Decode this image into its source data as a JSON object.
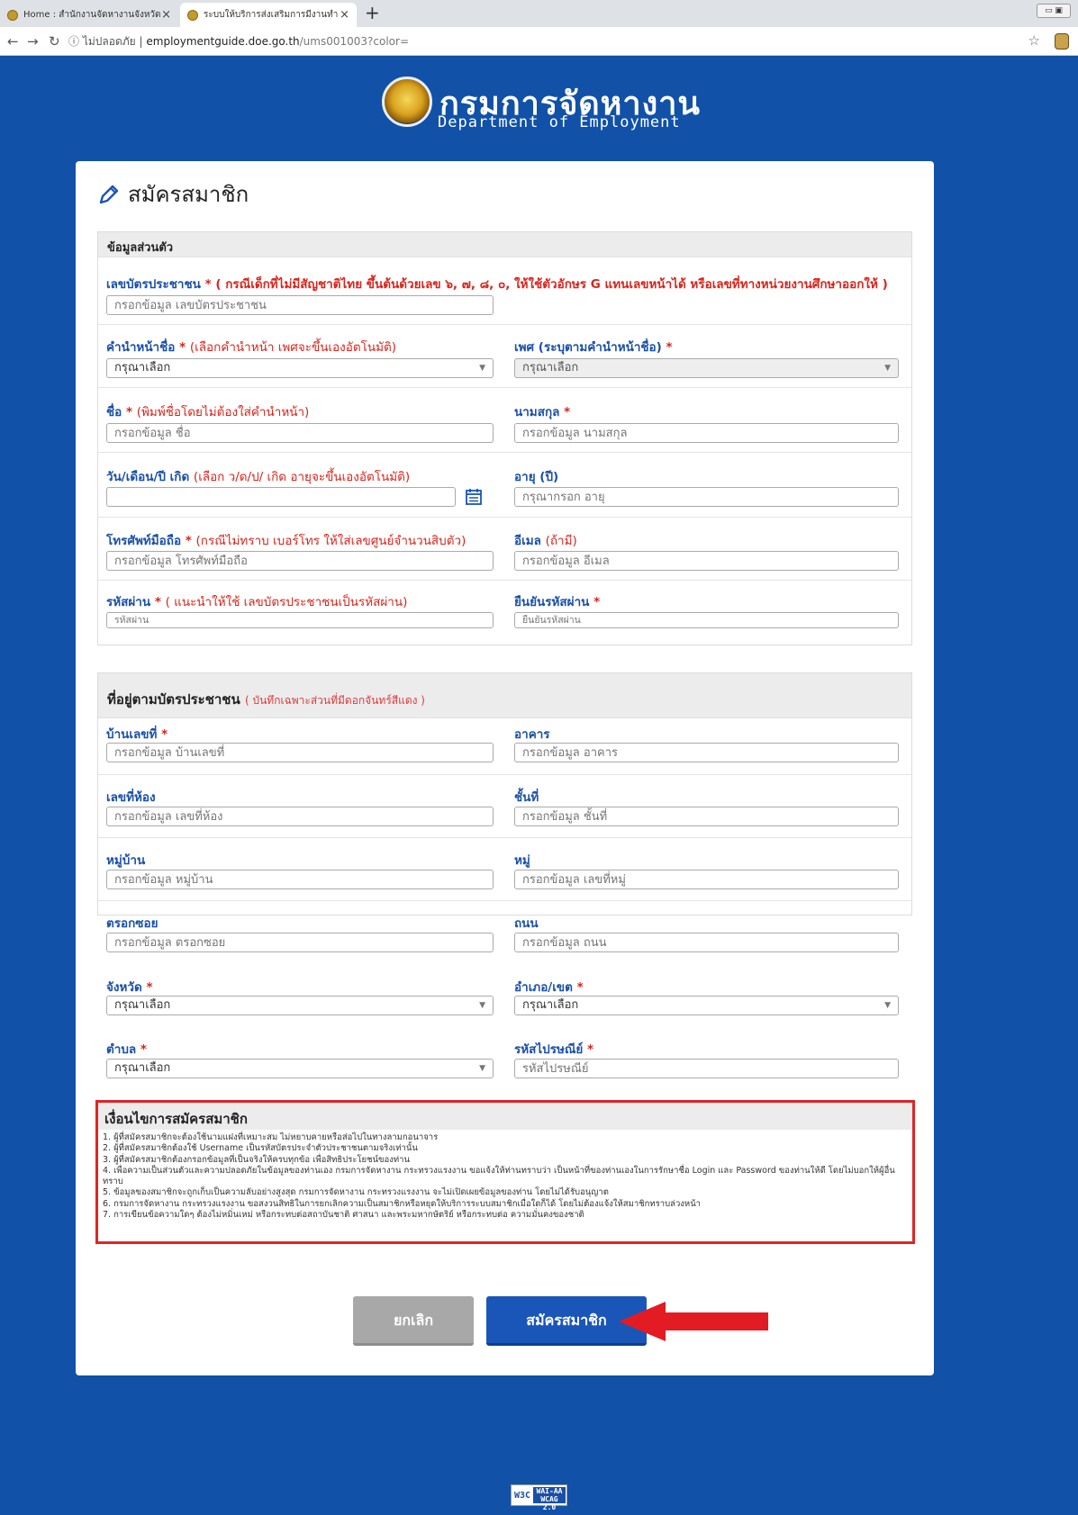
{
  "browser": {
    "tabs": [
      {
        "title": "Home : สำนักงานจัดหางานจังหวัดแม่ฮ่"
      },
      {
        "title": "ระบบให้บริการส่งเสริมการมีงานทำ"
      }
    ],
    "new_tab": "+",
    "close": "×",
    "security": "ไม่ปลอดภัย",
    "url_host": "employmentguide.doe.go.th",
    "url_path": "/ums001003?color="
  },
  "header": {
    "title": "กรมการจัดหางาน",
    "subtitle": "Department of Employment"
  },
  "page_title": "สมัครสมาชิก",
  "personal": {
    "heading": "ข้อมูลส่วนตัว",
    "id_card": {
      "label": "เลขบัตรประชาชน",
      "note": "( กรณีเด็กที่ไม่มีสัญชาติไทย ขึ้นต้นด้วยเลข ๖, ๗, ๘, ๐, ให้ใช้ตัวอักษร G แทนเลขหน้าได้ หรือเลขที่ทางหน่วยงานศึกษาออกให้ )",
      "placeholder": "กรอกข้อมูล เลขบัตรประชาชน"
    },
    "prefix": {
      "label": "คำนำหน้าชื่อ",
      "note": "(เลือกคำนำหน้า เพศจะขึ้นเองอัตโนมัติ)",
      "value": "กรุณาเลือก"
    },
    "gender": {
      "label": "เพศ (ระบุตามคำนำหน้าชื่อ)",
      "value": "กรุณาเลือก"
    },
    "first_name": {
      "label": "ชื่อ",
      "note": "(พิมพ์ชื่อโดยไม่ต้องใส่คำนำหน้า)",
      "placeholder": "กรอกข้อมูล ชื่อ"
    },
    "last_name": {
      "label": "นามสกุล",
      "placeholder": "กรอกข้อมูล นามสกุล"
    },
    "birth_date": {
      "label": "วัน/เดือน/ปี เกิด",
      "note": "(เลือก ว/ด/ป/ เกิด อายุจะขึ้นเองอัตโนมัติ)",
      "value": ""
    },
    "age": {
      "label": "อายุ (ปี)",
      "placeholder": "กรุณากรอก อายุ"
    },
    "mobile": {
      "label": "โทรศัพท์มือถือ",
      "note": "(กรณีไม่ทราบ เบอร์โทร ให้ใส่เลขศูนย์จำนวนสิบตัว)",
      "placeholder": "กรอกข้อมูล โทรศัพท์มือถือ"
    },
    "email": {
      "label": "อีเมล",
      "note": "(ถ้ามี)",
      "placeholder": "กรอกข้อมูล อีเมล"
    },
    "password": {
      "label": "รหัสผ่าน",
      "note": "( แนะนำให้ใช้ เลขบัตรประชาชนเป็นรหัสผ่าน)",
      "placeholder": "รหัสผ่าน"
    },
    "password_confirm": {
      "label": "ยืนยันรหัสผ่าน",
      "placeholder": "ยืนยันรหัสผ่าน"
    }
  },
  "address": {
    "heading": "ที่อยู่ตามบัตรประชาชน",
    "heading_note": "( บันทึกเฉพาะส่วนที่มีดอกจันทร์สีแดง )",
    "house_no": {
      "label": "บ้านเลขที่",
      "placeholder": "กรอกข้อมูล บ้านเลขที่"
    },
    "building": {
      "label": "อาคาร",
      "placeholder": "กรอกข้อมูล อาคาร"
    },
    "room_no": {
      "label": "เลขที่ห้อง",
      "placeholder": "กรอกข้อมูล เลขที่ห้อง"
    },
    "floor": {
      "label": "ชั้นที่",
      "placeholder": "กรอกข้อมูล ชั้นที่"
    },
    "village": {
      "label": "หมู่บ้าน",
      "placeholder": "กรอกข้อมูล หมู่บ้าน"
    },
    "moo": {
      "label": "หมู่",
      "placeholder": "กรอกข้อมูล เลขที่หมู่"
    },
    "soi": {
      "label": "ตรอกซอย",
      "placeholder": "กรอกข้อมูล ตรอกซอย"
    },
    "road": {
      "label": "ถนน",
      "placeholder": "กรอกข้อมูล ถนน"
    },
    "province": {
      "label": "จังหวัด",
      "value": "กรุณาเลือก"
    },
    "district": {
      "label": "อำเภอ/เขต",
      "value": "กรุณาเลือก"
    },
    "subdistrict": {
      "label": "ตำบล",
      "value": "กรุณาเลือก"
    },
    "postcode": {
      "label": "รหัสไปรษณีย์",
      "placeholder": "รหัสไปรษณีย์"
    }
  },
  "terms": {
    "heading": "เงื่อนไขการสมัครสมาชิก",
    "items": [
      "1. ผู้ที่สมัครสมาชิกจะต้องใช้นามแฝงที่เหมาะสม ไม่หยาบคายหรือส่อไปในทางลามกอนาจาร",
      "2. ผู้ที่สมัครสมาชิกต้องใช้ Username เป็นรหัสบัตรประจำตัวประชาชนตามจริงเท่านั้น",
      "3. ผู้ที่สมัครสมาชิกต้องกรอกข้อมูลที่เป็นจริงให้ครบทุกข้อ เพื่อสิทธิประโยชน์ของท่าน",
      "4. เพื่อความเป็นส่วนตัวและความปลอดภัยในข้อมูลของท่านเอง กรมการจัดหางาน กระทรวงแรงงาน ขอแจ้งให้ท่านทราบว่า เป็นหน้าที่ของท่านเองในการรักษาชื่อ Login และ Password ของท่านให้ดี โดยไม่บอกให้ผู้อื่นทราบ",
      "5. ข้อมูลของสมาชิกจะถูกเก็บเป็นความลับอย่างสูงสุด กรมการจัดหางาน กระทรวงแรงงาน จะไม่เปิดเผยข้อมูลของท่าน โดยไม่ได้รับอนุญาต",
      "6. กรมการจัดหางาน กระทรวงแรงงาน ขอสงวนสิทธิในการยกเลิกความเป็นสมาชิกหรือหยุดให้บริการระบบสมาชิกเมื่อใดก็ได้ โดยไม่ต้องแจ้งให้สมาชิกทราบล่วงหน้า",
      "7. การเขียนข้อความใดๆ ต้องไม่หมิ่นเหม่ หรือกระทบต่อสถาบันชาติ ศาสนา และพระมหากษัตริย์ หรือกระทบต่อ ความมั่นคงของชาติ"
    ]
  },
  "buttons": {
    "cancel": "ยกเลิก",
    "submit": "สมัครสมาชิก"
  },
  "footer": {
    "badge_left": "W3C",
    "badge_line1": "WAI-AA",
    "badge_line2": "WCAG 2.0"
  },
  "colors": {
    "background": "#1151a8",
    "label": "#1a50a8",
    "required": "#d9241b",
    "highlight": "#e02424",
    "arrow": "#e31b23"
  },
  "icons": [
    "pencil-icon",
    "calendar-icon",
    "chevron-down-icon",
    "arrow-icon"
  ]
}
